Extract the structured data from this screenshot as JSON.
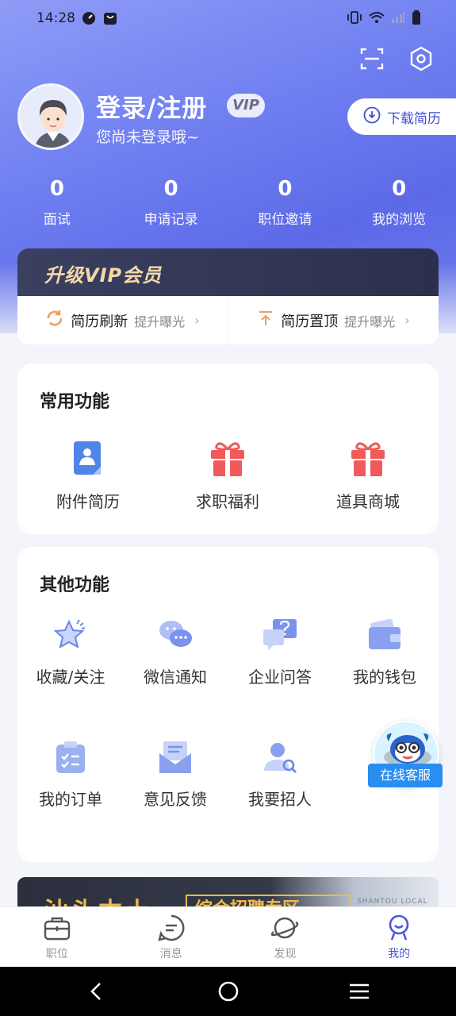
{
  "status_bar": {
    "time": "14:28"
  },
  "profile": {
    "title": "登录/注册",
    "vip_badge": "VIP",
    "subtitle": "您尚未登录哦~",
    "download_label": "下载简历"
  },
  "stats": [
    {
      "value": "0",
      "label": "面试"
    },
    {
      "value": "0",
      "label": "申请记录"
    },
    {
      "value": "0",
      "label": "职位邀请"
    },
    {
      "value": "0",
      "label": "我的浏览"
    }
  ],
  "vip_bar": {
    "title": "升级VIP会员"
  },
  "boosts": [
    {
      "label": "简历刷新",
      "sub": "提升曝光"
    },
    {
      "label": "简历置顶",
      "sub": "提升曝光"
    }
  ],
  "common": {
    "title": "常用功能",
    "items": [
      {
        "label": "附件简历",
        "icon": "resume-icon"
      },
      {
        "label": "求职福利",
        "icon": "gift-icon"
      },
      {
        "label": "道具商城",
        "icon": "gift-icon"
      }
    ]
  },
  "other": {
    "title": "其他功能",
    "items": [
      {
        "label": "收藏/关注",
        "icon": "star-icon"
      },
      {
        "label": "微信通知",
        "icon": "wechat-icon"
      },
      {
        "label": "企业问答",
        "icon": "qa-icon"
      },
      {
        "label": "我的钱包",
        "icon": "wallet-icon"
      },
      {
        "label": "我的订单",
        "icon": "order-icon"
      },
      {
        "label": "意见反馈",
        "icon": "feedback-icon"
      },
      {
        "label": "我要招人",
        "icon": "recruit-icon"
      }
    ]
  },
  "service": {
    "label": "在线客服"
  },
  "banner": {
    "title": "汕头本土",
    "subtitle": "综合招聘专区",
    "tag": "SHANTOU LOCAL"
  },
  "tabs": [
    {
      "label": "职位",
      "icon": "briefcase-icon"
    },
    {
      "label": "消息",
      "icon": "message-icon"
    },
    {
      "label": "发现",
      "icon": "planet-icon"
    },
    {
      "label": "我的",
      "icon": "profile-icon"
    }
  ],
  "colors": {
    "accent": "#4a57e0",
    "header": "#6f7ff0",
    "gift": "#f05a5a",
    "vip_gold": "#f4d9a8"
  }
}
